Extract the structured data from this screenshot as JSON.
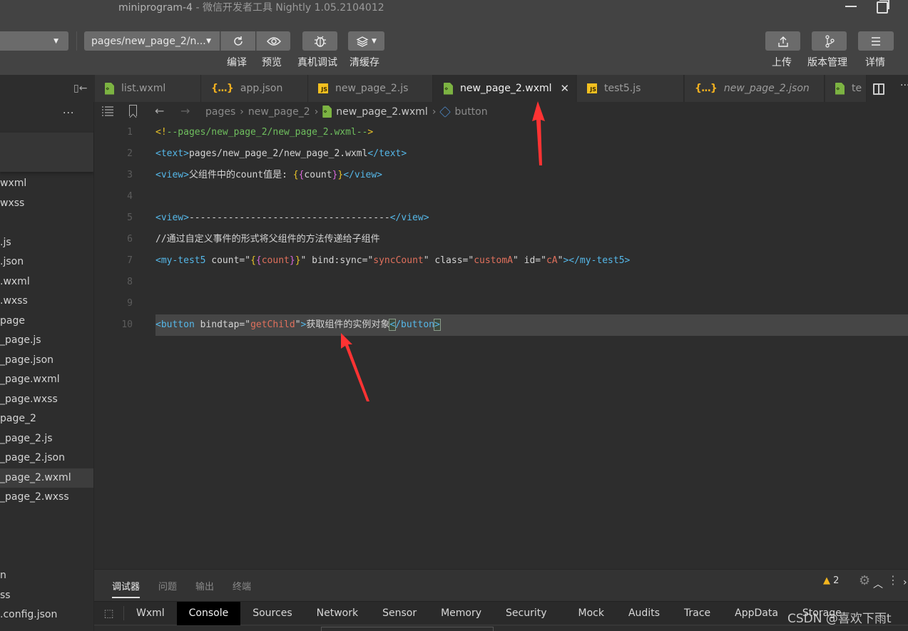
{
  "window": {
    "project": "miniprogram-4",
    "separator": " - ",
    "app_name": "微信开发者工具 Nightly 1.05.2104012"
  },
  "toolbar": {
    "page_select": "pages/new_page_2/n...",
    "compile_label": "编译",
    "preview_label": "预览",
    "debug_label": "真机调试",
    "cache_label": "清缓存",
    "upload_label": "上传",
    "version_label": "版本管理",
    "detail_label": "详情"
  },
  "tabs": [
    {
      "label": "list.wxml",
      "icon": "wxml-file-icon",
      "active": false,
      "italic": false
    },
    {
      "label": "app.json",
      "icon": "json-file-icon",
      "active": false,
      "italic": false
    },
    {
      "label": "new_page_2.js",
      "icon": "js-file-icon",
      "active": false,
      "italic": false
    },
    {
      "label": "new_page_2.wxml",
      "icon": "wxml-file-icon",
      "active": true,
      "italic": false
    },
    {
      "label": "test5.js",
      "icon": "js-file-icon",
      "active": false,
      "italic": false
    },
    {
      "label": "new_page_2.json",
      "icon": "json-file-icon",
      "active": false,
      "italic": true
    },
    {
      "label": "te",
      "icon": "wxml-file-icon",
      "active": false,
      "italic": false
    }
  ],
  "icons": {
    "json": "{...}",
    "js": "JS",
    "close": "✕",
    "more": "···",
    "list": "☰",
    "back": "←",
    "forward": "→",
    "collapse": "▯←",
    "chevron_up": "︿",
    "gear": "⚙",
    "kebab": "⋮",
    "warning": "▲"
  },
  "sidebar": {
    "files": [
      {
        "label": "wxml",
        "selected": false
      },
      {
        "label": "wxss",
        "selected": false
      },
      {
        "label": "",
        "selected": false
      },
      {
        "label": ".js",
        "selected": false
      },
      {
        "label": ".json",
        "selected": false
      },
      {
        "label": ".wxml",
        "selected": false
      },
      {
        "label": ".wxss",
        "selected": false
      },
      {
        "label": "page",
        "selected": false
      },
      {
        "label": "_page.js",
        "selected": false
      },
      {
        "label": "_page.json",
        "selected": false
      },
      {
        "label": "_page.wxml",
        "selected": false
      },
      {
        "label": "_page.wxss",
        "selected": false
      },
      {
        "label": "page_2",
        "selected": false
      },
      {
        "label": "_page_2.js",
        "selected": false
      },
      {
        "label": "_page_2.json",
        "selected": false
      },
      {
        "label": "_page_2.wxml",
        "selected": true
      },
      {
        "label": "_page_2.wxss",
        "selected": false
      }
    ],
    "bottom_files": [
      {
        "label": "n"
      },
      {
        "label": "ss"
      },
      {
        "label": ".config.json"
      }
    ]
  },
  "breadcrumb": {
    "segments": [
      "pages",
      "new_page_2"
    ],
    "file": "new_page_2.wxml",
    "symbol": "button"
  },
  "editor": {
    "lines": [
      {
        "n": "1",
        "tokens": [
          [
            "c-comment-br",
            "<!"
          ],
          [
            "c-comment",
            "--pages/new_page_2/new_page_2.wxml--"
          ],
          [
            "c-comment-br",
            ">"
          ]
        ]
      },
      {
        "n": "2",
        "tokens": [
          [
            "c-tag",
            "<text>"
          ],
          [
            "c-text",
            "pages/new_page_2/new_page_2.wxml"
          ],
          [
            "c-tag",
            "</text>"
          ]
        ]
      },
      {
        "n": "3",
        "tokens": [
          [
            "c-tag",
            "<view>"
          ],
          [
            "c-text",
            "父组件中的count值是: "
          ],
          [
            "c-brace1",
            "{"
          ],
          [
            "c-brace2",
            "{"
          ],
          [
            "c-text",
            "count"
          ],
          [
            "c-brace2",
            "}"
          ],
          [
            "c-brace1",
            "}"
          ],
          [
            "c-tag",
            "</view>"
          ]
        ]
      },
      {
        "n": "4",
        "tokens": []
      },
      {
        "n": "5",
        "tokens": [
          [
            "c-tag",
            "<view>"
          ],
          [
            "c-text",
            "------------------------------------"
          ],
          [
            "c-tag",
            "</view>"
          ]
        ]
      },
      {
        "n": "6",
        "tokens": [
          [
            "c-text",
            "//通过自定义事件的形式将父组件的方法传递给子组件"
          ]
        ]
      },
      {
        "n": "7",
        "tokens": [
          [
            "c-tag",
            "<my-test5"
          ],
          [
            "c-attr",
            " count="
          ],
          [
            "c-text",
            "\""
          ],
          [
            "c-brace1",
            "{"
          ],
          [
            "c-brace2",
            "{"
          ],
          [
            "c-str",
            "count"
          ],
          [
            "c-brace2",
            "}"
          ],
          [
            "c-brace1",
            "}"
          ],
          [
            "c-text",
            "\""
          ],
          [
            "c-attr",
            " bind:sync="
          ],
          [
            "c-text",
            "\""
          ],
          [
            "c-str",
            "syncCount"
          ],
          [
            "c-text",
            "\""
          ],
          [
            "c-attr",
            " class="
          ],
          [
            "c-text",
            "\""
          ],
          [
            "c-str",
            "customA"
          ],
          [
            "c-text",
            "\""
          ],
          [
            "c-attr",
            " id="
          ],
          [
            "c-text",
            "\""
          ],
          [
            "c-str",
            "cA"
          ],
          [
            "c-text",
            "\""
          ],
          [
            "c-tag",
            "></my-test5>"
          ]
        ]
      },
      {
        "n": "8",
        "tokens": []
      },
      {
        "n": "9",
        "tokens": []
      },
      {
        "n": "10",
        "current": true,
        "tokens": [
          [
            "c-tag",
            "<button"
          ],
          [
            "c-attr",
            " bindtap="
          ],
          [
            "c-text",
            "\""
          ],
          [
            "c-str",
            "getChild"
          ],
          [
            "c-text",
            "\""
          ],
          [
            "c-tag",
            ">"
          ],
          [
            "c-text",
            "获取组件的实例对象"
          ],
          [
            "c-tag c-match",
            "<"
          ],
          [
            "c-tag",
            "/button"
          ],
          [
            "c-tag c-match",
            ">"
          ]
        ]
      }
    ]
  },
  "devtools": {
    "tabs": [
      {
        "label": "调试器",
        "active": true
      },
      {
        "label": "问题",
        "active": false
      },
      {
        "label": "输出",
        "active": false
      },
      {
        "label": "终端",
        "active": false
      }
    ],
    "panels": [
      {
        "label": "Wxml",
        "active": false
      },
      {
        "label": "Console",
        "active": true
      },
      {
        "label": "Sources",
        "active": false
      },
      {
        "label": "Network",
        "active": false
      },
      {
        "label": "Sensor",
        "active": false
      },
      {
        "label": "Memory",
        "active": false
      },
      {
        "label": "Security",
        "active": false
      },
      {
        "label": "Mock",
        "active": false
      },
      {
        "label": "Audits",
        "active": false
      },
      {
        "label": "Trace",
        "active": false
      },
      {
        "label": "AppData",
        "active": false
      },
      {
        "label": "Storage",
        "active": false
      }
    ],
    "warning_count": "2"
  },
  "watermark": "CSDN @喜欢下雨t",
  "colors": {
    "accent_annotation": "#ff3333",
    "wxml_icon": "#7cb342",
    "js_icon": "#f4c020",
    "json_icon": "#f0b020"
  }
}
